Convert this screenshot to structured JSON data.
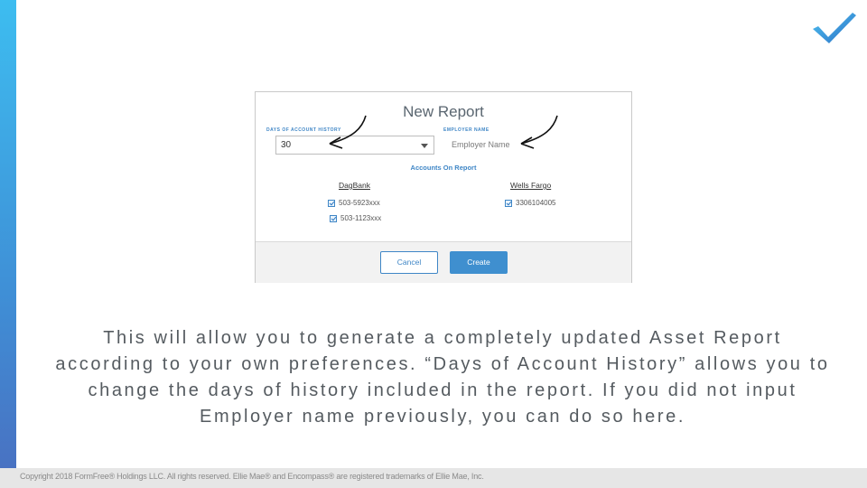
{
  "dialog": {
    "title": "New Report",
    "days_label": "DAYS OF ACCOUNT HISTORY",
    "days_value": "30",
    "employer_label": "EMPLOYER NAME",
    "employer_value": "Employer Name",
    "section_title": "Accounts On Report",
    "banks": [
      {
        "name": "DagBank",
        "accounts": [
          "503-5923xxx",
          "503-1123xxx"
        ]
      },
      {
        "name": "Wells Fargo",
        "accounts": [
          "3306104005"
        ]
      }
    ],
    "cancel_label": "Cancel",
    "create_label": "Create"
  },
  "caption": "This will allow you to generate a completely updated Asset Report according to your own preferences. “Days of Account History” allows you to change the days of history included in the report. If you did not input Employer name previously, you can do so here.",
  "footer": "Copyright 2018 FormFree® Holdings LLC. All rights reserved. Ellie Mae® and Encompass® are registered trademarks of Ellie Mae, Inc.",
  "colors": {
    "accent": "#3f86c6",
    "bar_top": "#3dbdf0",
    "bar_bottom": "#4a6fc0"
  }
}
